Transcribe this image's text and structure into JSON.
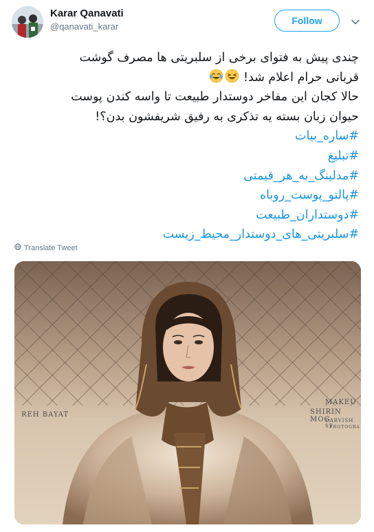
{
  "user": {
    "name": "Karar Qanavati",
    "handle": "@qanavati_karar"
  },
  "follow_label": "Follow",
  "tweet": {
    "line1": "چندی پیش به فتوای برخی از سلبریتی ها مصرف گوشت",
    "line2": "قربانی حرام اعلام شد!",
    "line3": "حالا کجان این مفاخر دوستدار طبیعت تا واسه کندن پوست",
    "line4": "حیوان زبان بسته یه تذکری به رفیق شریفشون بدن؟!",
    "hashtags": [
      "#ساره_بیات",
      "#تبلیغ",
      "#مدلینگ_به_هر_قیمتی",
      "#پالتو_پوست_روباه",
      "#دوستداران_طبیعت",
      "#سلبریتی_های_دوستدار_محیط_زیست"
    ]
  },
  "translate_label": "Translate Tweet",
  "media": {
    "caption_left": "REH BAYAT",
    "caption_right_1": "MAKEU",
    "caption_right_2": "SHIRIN MOG",
    "caption_right_3": "DARVISH ST",
    "caption_right_4": "PHOTOGRA"
  },
  "colors": {
    "accent": "#1da1f2",
    "hashtag": "#1b95e0",
    "muted": "#657786"
  },
  "icons": {
    "caret": "chevron-down-icon",
    "globe": "globe-icon",
    "emoji": "laughing-emoji-icon"
  }
}
